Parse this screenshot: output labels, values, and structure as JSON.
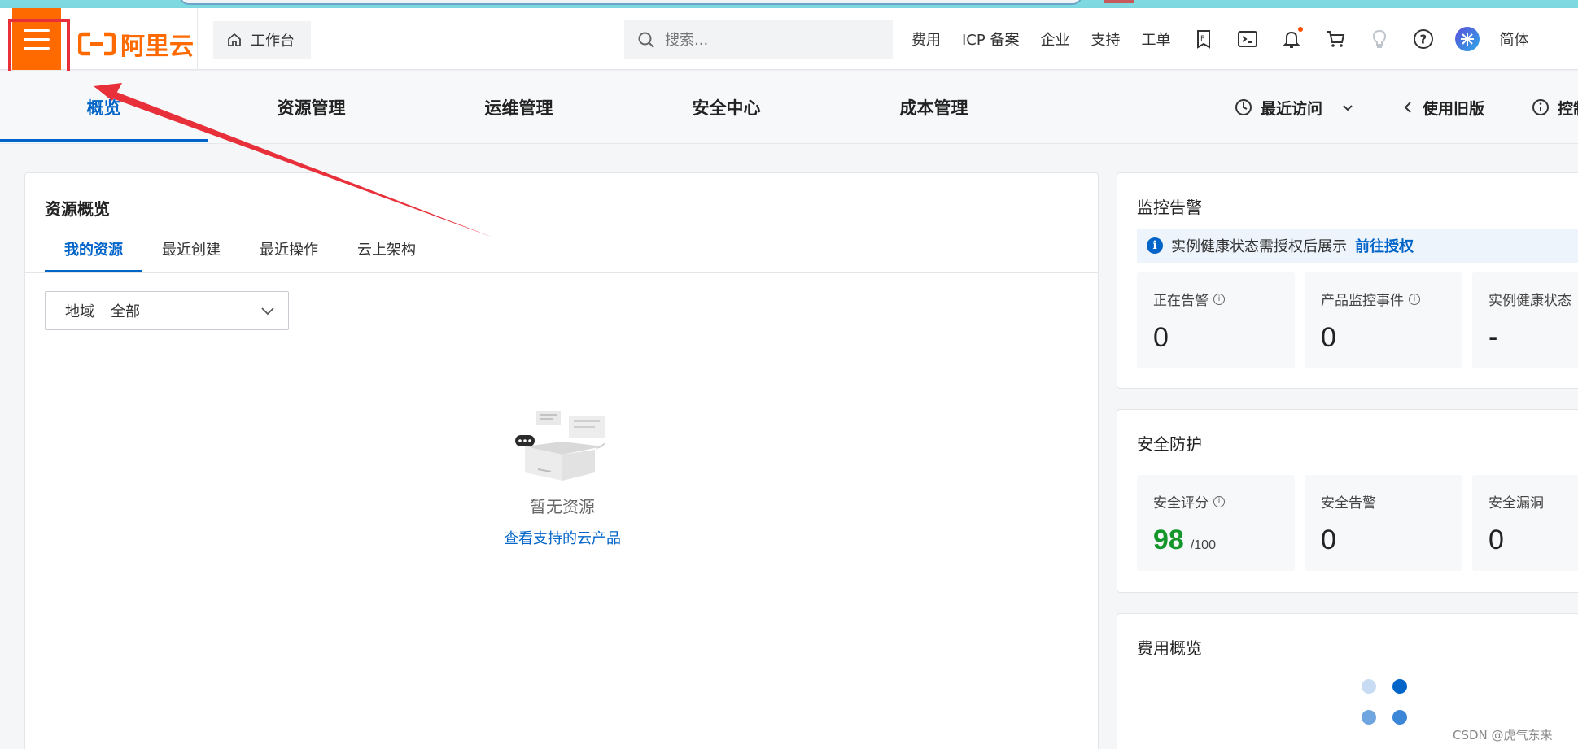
{
  "header": {
    "logo_text": "阿里云",
    "workbench_label": "工作台",
    "search_placeholder": "搜索...",
    "nav": [
      "费用",
      "ICP 备案",
      "企业",
      "支持",
      "工单"
    ],
    "lang_label": "简体"
  },
  "mainnav": {
    "tabs": [
      "概览",
      "资源管理",
      "运维管理",
      "安全中心",
      "成本管理"
    ],
    "active_tab": "概览",
    "recent_label": "最近访问",
    "old_version_label": "使用旧版",
    "control_label": "控制"
  },
  "resource": {
    "title": "资源概览",
    "subtabs": [
      "我的资源",
      "最近创建",
      "最近操作",
      "云上架构"
    ],
    "region_label": "地域",
    "region_value": "全部",
    "empty_message": "暂无资源",
    "empty_link": "查看支持的云产品"
  },
  "monitor": {
    "title": "监控告警",
    "info_text": "实例健康状态需授权后展示",
    "info_link": "前往授权",
    "stats": [
      {
        "label": "正在告警",
        "value": "0"
      },
      {
        "label": "产品监控事件",
        "value": "0"
      },
      {
        "label": "实例健康状态",
        "value": "-"
      }
    ]
  },
  "security": {
    "title": "安全防护",
    "stats": [
      {
        "label": "安全评分",
        "value": "98",
        "suffix": "/100"
      },
      {
        "label": "安全告警",
        "value": "0"
      },
      {
        "label": "安全漏洞",
        "value": "0"
      }
    ]
  },
  "fee": {
    "title": "费用概览"
  },
  "watermark": "CSDN @虎气东来",
  "colors": {
    "brand_orange": "#ff6a00",
    "primary_blue": "#0064c8",
    "score_green": "#14962b",
    "annotation_red": "#e8303a"
  }
}
